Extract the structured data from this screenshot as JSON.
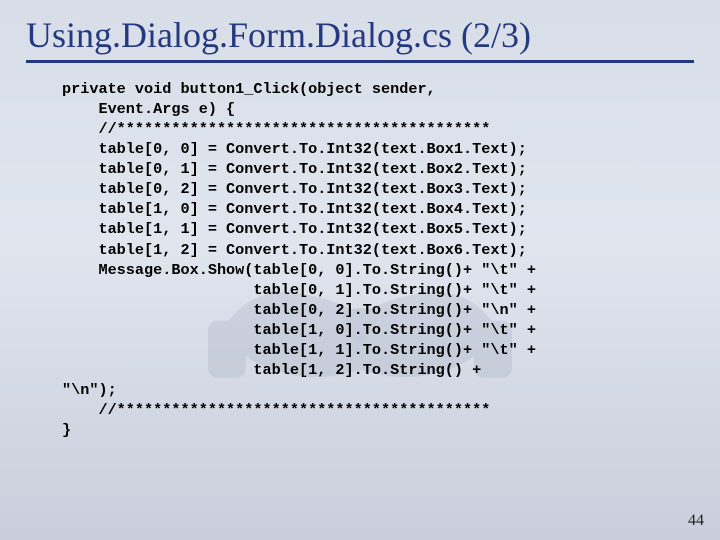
{
  "title": "Using.Dialog.Form.Dialog.cs (2/3)",
  "page_number": "44",
  "code": "private void button1_Click(object sender,\n    Event.Args e) {\n    //*****************************************\n    table[0, 0] = Convert.To.Int32(text.Box1.Text);\n    table[0, 1] = Convert.To.Int32(text.Box2.Text);\n    table[0, 2] = Convert.To.Int32(text.Box3.Text);\n    table[1, 0] = Convert.To.Int32(text.Box4.Text);\n    table[1, 1] = Convert.To.Int32(text.Box5.Text);\n    table[1, 2] = Convert.To.Int32(text.Box6.Text);\n    Message.Box.Show(table[0, 0].To.String()+ \"\\t\" +\n                     table[0, 1].To.String()+ \"\\t\" +\n                     table[0, 2].To.String()+ \"\\n\" +\n                     table[1, 0].To.String()+ \"\\t\" +\n                     table[1, 1].To.String()+ \"\\t\" +\n                     table[1, 2].To.String() +\n\"\\n\");\n    //*****************************************\n}"
}
